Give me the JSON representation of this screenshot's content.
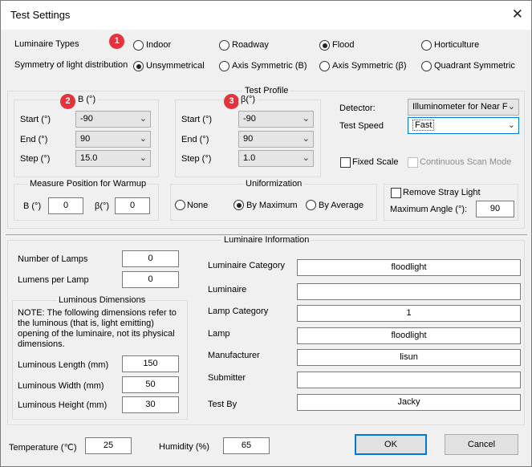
{
  "window": {
    "title": "Test Settings",
    "close_glyph": "✕"
  },
  "badges": [
    "1",
    "2",
    "3"
  ],
  "luminaire_types": {
    "label": "Luminaire Types",
    "options": [
      "Indoor",
      "Roadway",
      "Flood",
      "Horticulture"
    ],
    "selected": "Flood"
  },
  "symmetry": {
    "label": "Symmetry of light distribution",
    "options": [
      "Unsymmetrical",
      "Axis Symmetric (B)",
      "Axis Symmetric (β)",
      "Quadrant Symmetric"
    ],
    "selected": "Unsymmetrical"
  },
  "test_profile": {
    "title": "Test Profile",
    "b": {
      "header": "B (°)",
      "start_label": "Start (°)",
      "start": "-90",
      "end_label": "End (°)",
      "end": "90",
      "step_label": "Step (°)",
      "step": "15.0"
    },
    "beta": {
      "header": "β(°)",
      "start_label": "Start (°)",
      "start": "-90",
      "end_label": "End (°)",
      "end": "90",
      "step_label": "Step (°)",
      "step": "1.0"
    },
    "detector_label": "Detector:",
    "detector": "Illuminometer for Near F",
    "speed_label": "Test Speed",
    "speed": "Fast",
    "fixed_scale": {
      "label": "Fixed Scale",
      "checked": false
    },
    "continuous_scan": {
      "label": "Continuous Scan Mode",
      "checked": false,
      "enabled": false
    }
  },
  "warmup": {
    "title": "Measure Position for Warmup",
    "b_label": "B (°)",
    "b": "0",
    "beta_label": "β(°)",
    "beta": "0"
  },
  "uniformization": {
    "title": "Uniformization",
    "options": [
      "None",
      "By Maximum",
      "By Average"
    ],
    "selected": "By Maximum"
  },
  "stray": {
    "label": "Remove Stray Light",
    "checked": false,
    "max_angle_label": "Maximum Angle (°):",
    "max_angle": "90"
  },
  "info": {
    "title": "Luminaire Information",
    "lamps_label": "Number of Lamps",
    "lamps": "0",
    "lumens_label": "Lumens per Lamp",
    "lumens": "0",
    "dims_title": "Luminous Dimensions",
    "note": "NOTE: The following dimensions refer to the luminous (that is, light emitting) opening of the luminaire, not its physical dimensions.",
    "length_label": "Luminous Length (mm)",
    "length": "150",
    "width_label": "Luminous Width (mm)",
    "width": "50",
    "height_label": "Luminous Height (mm)",
    "height": "30",
    "fields": [
      {
        "label": "Luminaire Category",
        "value": "floodlight"
      },
      {
        "label": "Luminaire",
        "value": ""
      },
      {
        "label": "Lamp Category",
        "value": "1"
      },
      {
        "label": "Lamp",
        "value": "floodlight"
      },
      {
        "label": "Manufacturer",
        "value": "lisun"
      },
      {
        "label": "Submitter",
        "value": ""
      },
      {
        "label": "Test By",
        "value": "Jacky"
      }
    ]
  },
  "footer": {
    "temp_label": "Temperature (℃)",
    "temp": "25",
    "humidity_label": "Humidity (%)",
    "humidity": "65",
    "ok": "OK",
    "cancel": "Cancel"
  }
}
